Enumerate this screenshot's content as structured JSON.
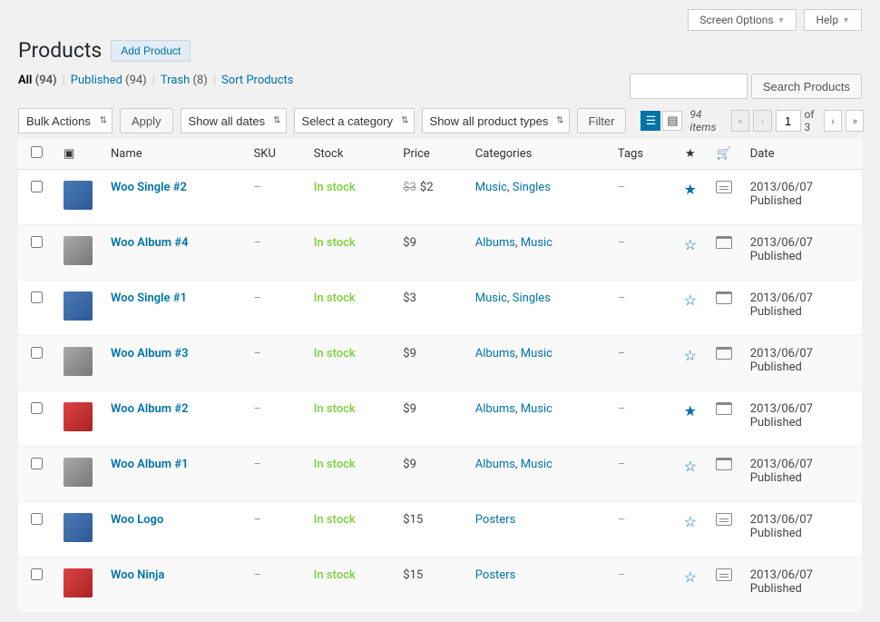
{
  "topbar": {
    "screen_options": "Screen Options",
    "help": "Help"
  },
  "header": {
    "title": "Products",
    "add_new": "Add Product"
  },
  "views": {
    "all": {
      "label": "All",
      "count": "(94)"
    },
    "published": {
      "label": "Published",
      "count": "(94)"
    },
    "trash": {
      "label": "Trash",
      "count": "(8)"
    },
    "sort": {
      "label": "Sort Products"
    }
  },
  "bulk": {
    "label": "Bulk Actions",
    "apply": "Apply"
  },
  "filters": {
    "dates": "Show all dates",
    "category": "Select a category",
    "types": "Show all product types",
    "filter_btn": "Filter"
  },
  "search": {
    "placeholder": "",
    "button": "Search Products"
  },
  "paging": {
    "items": "94 items",
    "current": "1",
    "of": "of 3"
  },
  "columns": {
    "name": "Name",
    "sku": "SKU",
    "stock": "Stock",
    "price": "Price",
    "categories": "Categories",
    "tags": "Tags",
    "date": "Date"
  },
  "rows": [
    {
      "thumb": "blue",
      "name": "Woo Single #2",
      "sku": "–",
      "stock": "In stock",
      "price_old": "$3",
      "price": "$2",
      "cats": [
        "Music",
        "Singles"
      ],
      "tags": "–",
      "featured": true,
      "type": "simple",
      "date": "2013/06/07",
      "status": "Published"
    },
    {
      "thumb": "gray",
      "name": "Woo Album #4",
      "sku": "–",
      "stock": "In stock",
      "price_old": "",
      "price": "$9",
      "cats": [
        "Albums",
        "Music"
      ],
      "tags": "–",
      "featured": false,
      "type": "variable",
      "date": "2013/06/07",
      "status": "Published"
    },
    {
      "thumb": "blue",
      "name": "Woo Single #1",
      "sku": "–",
      "stock": "In stock",
      "price_old": "",
      "price": "$3",
      "cats": [
        "Music",
        "Singles"
      ],
      "tags": "–",
      "featured": false,
      "type": "variable",
      "date": "2013/06/07",
      "status": "Published"
    },
    {
      "thumb": "gray",
      "name": "Woo Album #3",
      "sku": "–",
      "stock": "In stock",
      "price_old": "",
      "price": "$9",
      "cats": [
        "Albums",
        "Music"
      ],
      "tags": "–",
      "featured": false,
      "type": "variable",
      "date": "2013/06/07",
      "status": "Published"
    },
    {
      "thumb": "red",
      "name": "Woo Album #2",
      "sku": "–",
      "stock": "In stock",
      "price_old": "",
      "price": "$9",
      "cats": [
        "Albums",
        "Music"
      ],
      "tags": "–",
      "featured": true,
      "type": "variable",
      "date": "2013/06/07",
      "status": "Published"
    },
    {
      "thumb": "gray",
      "name": "Woo Album #1",
      "sku": "–",
      "stock": "In stock",
      "price_old": "",
      "price": "$9",
      "cats": [
        "Albums",
        "Music"
      ],
      "tags": "–",
      "featured": false,
      "type": "variable",
      "date": "2013/06/07",
      "status": "Published"
    },
    {
      "thumb": "blue",
      "name": "Woo Logo",
      "sku": "–",
      "stock": "In stock",
      "price_old": "",
      "price": "$15",
      "cats": [
        "Posters"
      ],
      "tags": "–",
      "featured": false,
      "type": "simple",
      "date": "2013/06/07",
      "status": "Published"
    },
    {
      "thumb": "red",
      "name": "Woo Ninja",
      "sku": "–",
      "stock": "In stock",
      "price_old": "",
      "price": "$15",
      "cats": [
        "Posters"
      ],
      "tags": "–",
      "featured": false,
      "type": "simple",
      "date": "2013/06/07",
      "status": "Published"
    }
  ]
}
